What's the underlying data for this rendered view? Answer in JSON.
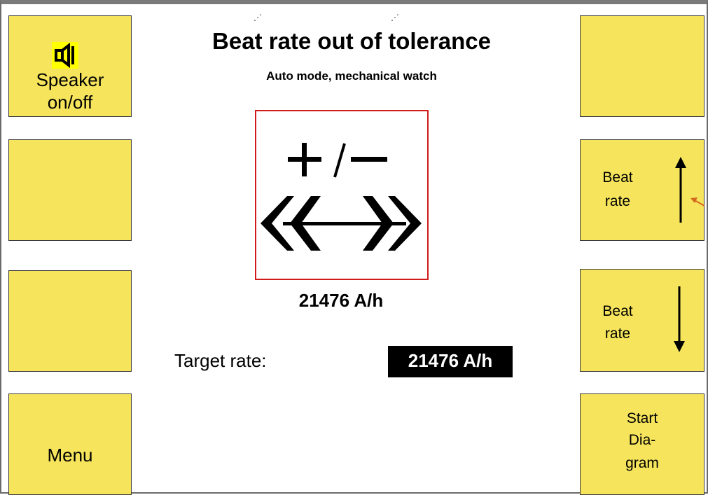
{
  "header": {
    "title": "Beat rate out of tolerance",
    "subtitle": "Auto mode, mechanical watch"
  },
  "left_keys": [
    {
      "label_line1": "Speaker",
      "label_line2": "on/off",
      "icon": "speaker-icon"
    },
    {
      "label": ""
    },
    {
      "label": ""
    },
    {
      "label": "Menu"
    }
  ],
  "right_keys": [
    {
      "label": ""
    },
    {
      "label_line1": "Beat",
      "label_line2": "rate",
      "icon": "arrow-up-icon"
    },
    {
      "label_line1": "Beat",
      "label_line2": "rate",
      "icon": "arrow-down-icon"
    },
    {
      "label_line1": "Start",
      "label_line2": "Dia-",
      "label_line3": "gram"
    }
  ],
  "indicator": {
    "icon": "plus-minus-double-arrow-icon",
    "frame_color": "#d11a1a"
  },
  "measured_rate": "21476 A/h",
  "target": {
    "label": "Target rate:",
    "value": "21476 A/h"
  },
  "colors": {
    "softkey": "#f6e55c",
    "speaker_highlight": "#ffff00",
    "annotation_arrow": "#d2691e"
  }
}
